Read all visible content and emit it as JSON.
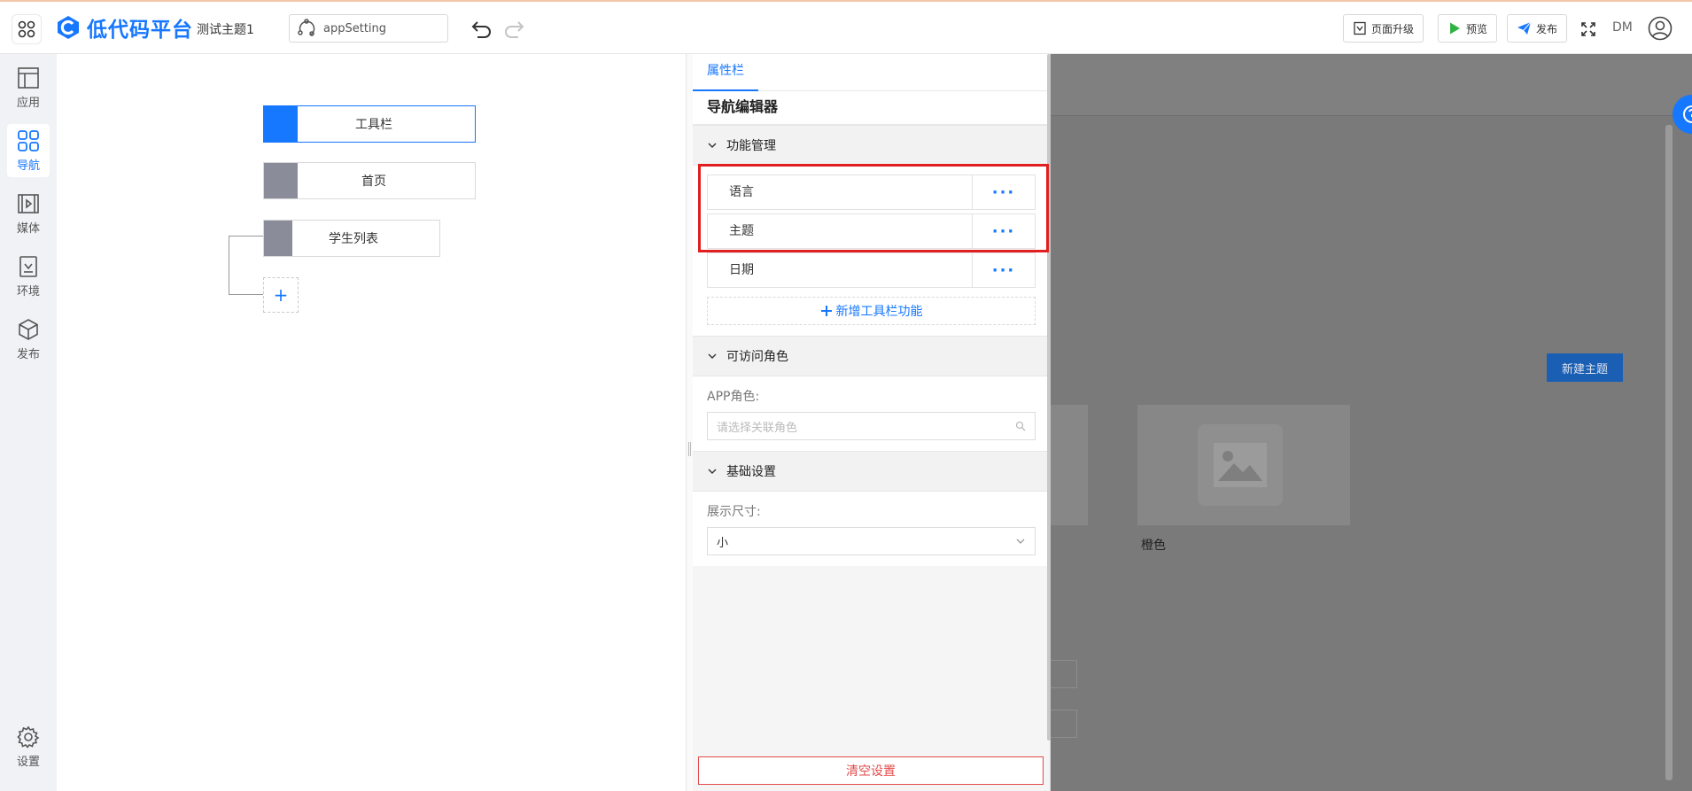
{
  "header": {
    "logo_text": "低代码平台",
    "project_name": "测试主题1",
    "page_select_value": "appSetting",
    "buttons": {
      "upgrade": "页面升级",
      "preview": "预览",
      "publish": "发布"
    },
    "user_initials": "DM"
  },
  "sidebar": {
    "items": [
      {
        "label": "应用",
        "icon": "layout-icon"
      },
      {
        "label": "导航",
        "icon": "grid-icon"
      },
      {
        "label": "媒体",
        "icon": "media-icon"
      },
      {
        "label": "环境",
        "icon": "env-icon"
      },
      {
        "label": "发布",
        "icon": "cube-icon"
      }
    ],
    "settings_label": "设置",
    "active_index": 1
  },
  "canvas": {
    "nodes": [
      {
        "label": "工具栏",
        "active": true
      },
      {
        "label": "首页",
        "active": false
      },
      {
        "label": "学生列表",
        "active": false
      }
    ],
    "add_symbol": "+"
  },
  "panel": {
    "tab_label": "属性栏",
    "title": "导航编辑器",
    "function_section": {
      "title": "功能管理",
      "items": [
        "语言",
        "主题",
        "日期"
      ],
      "more_symbol": "···",
      "add_label": "新增工具栏功能"
    },
    "role_section": {
      "title": "可访问角色",
      "field_label": "APP角色:",
      "placeholder": "请选择关联角色"
    },
    "basic_section": {
      "title": "基础设置",
      "field_label": "展示尺寸:",
      "value": "小"
    },
    "clear_label": "清空设置"
  },
  "background": {
    "new_theme_label": "新建主题",
    "card_caption": "橙色"
  },
  "colors": {
    "accent": "#1677ff",
    "danger": "#e34b4b",
    "highlight": "#e02020"
  }
}
